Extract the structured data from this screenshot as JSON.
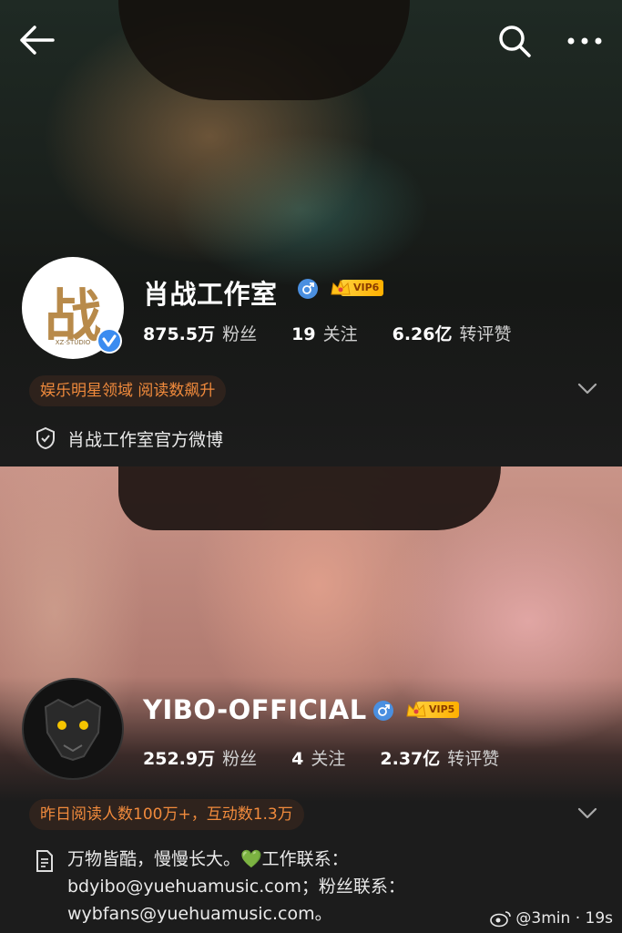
{
  "profile1": {
    "name": "肖战工作室",
    "vip": "VIP6",
    "avatar_char": "战",
    "avatar_sub": "XZ·STUDIO",
    "stats": [
      {
        "num": "875.5万",
        "label": "粉丝"
      },
      {
        "num": "19",
        "label": "关注"
      },
      {
        "num": "6.26亿",
        "label": "转评赞"
      }
    ],
    "tag": "娱乐明星领域 阅读数飙升",
    "desc": "肖战工作室官方微博"
  },
  "profile2": {
    "name": "YIBO-OFFICIAL",
    "vip": "VIP5",
    "stats": [
      {
        "num": "252.9万",
        "label": "粉丝"
      },
      {
        "num": "4",
        "label": "关注"
      },
      {
        "num": "2.37亿",
        "label": "转评赞"
      }
    ],
    "tag": "昨日阅读人数100万+，互动数1.3万",
    "bio_lines": [
      "万物皆酷，慢慢长大。💚工作联系：",
      "bdyibo@yuehuamusic.com；粉丝联系：",
      "wybfans@yuehuamusic.com。"
    ]
  },
  "watermark": "@3min · 19s",
  "colors": {
    "accent": "#f08a3c",
    "vip_gold": "#ffc21a",
    "gender_blue": "#4a8fe0"
  }
}
